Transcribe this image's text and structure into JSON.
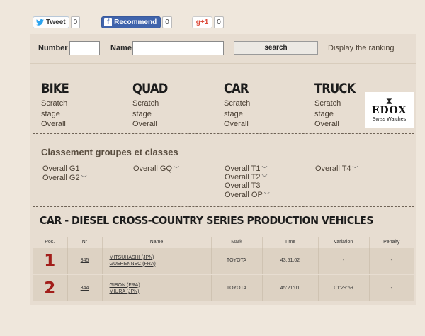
{
  "social": {
    "tweet_label": "Tweet",
    "tweet_count": "0",
    "facebook_label": "Recommend",
    "facebook_count": "0",
    "gplus_label": "+1",
    "gplus_count": "0"
  },
  "search": {
    "number_label": "Number",
    "name_label": "Name",
    "button_label": "search",
    "ranking_link": "Display the ranking"
  },
  "categories": [
    {
      "name": "BIKE",
      "links": [
        "Scratch",
        "stage",
        "Overall"
      ]
    },
    {
      "name": "QUAD",
      "links": [
        "Scratch",
        "stage",
        "Overall"
      ]
    },
    {
      "name": "CAR",
      "links": [
        "Scratch",
        "stage",
        "Overall"
      ]
    },
    {
      "name": "TRUCK",
      "links": [
        "Scratch",
        "stage",
        "Overall"
      ]
    }
  ],
  "sponsor": {
    "brand": "EDOX",
    "tagline": "Swiss Watches"
  },
  "groups": {
    "title": "Classement groupes et classes",
    "bike": [
      "Overall G1",
      "Overall G2"
    ],
    "quad": [
      "Overall GQ"
    ],
    "car": [
      "Overall T1",
      "Overall T2",
      "Overall T3",
      "Overall OP"
    ],
    "truck": [
      "Overall T4"
    ]
  },
  "results": {
    "title": "CAR - DIESEL CROSS-COUNTRY SERIES PRODUCTION VEHICLES",
    "columns": [
      "Pos.",
      "N°",
      "Name",
      "Mark",
      "Time",
      "variation",
      "Penalty"
    ],
    "rows": [
      {
        "pos": "1",
        "num": "345",
        "driver": "MITSUHASHI (JPN)",
        "codriver": "GUEHENNEC (FRA)",
        "mark": "TOYOTA",
        "time": "43:51:02",
        "variation": "-",
        "penalty": "-"
      },
      {
        "pos": "2",
        "num": "344",
        "driver": "GIBON (FRA)",
        "codriver": "MIURA (JPN)",
        "mark": "TOYOTA",
        "time": "45:21:01",
        "variation": "01:29:59",
        "penalty": "-"
      }
    ]
  }
}
